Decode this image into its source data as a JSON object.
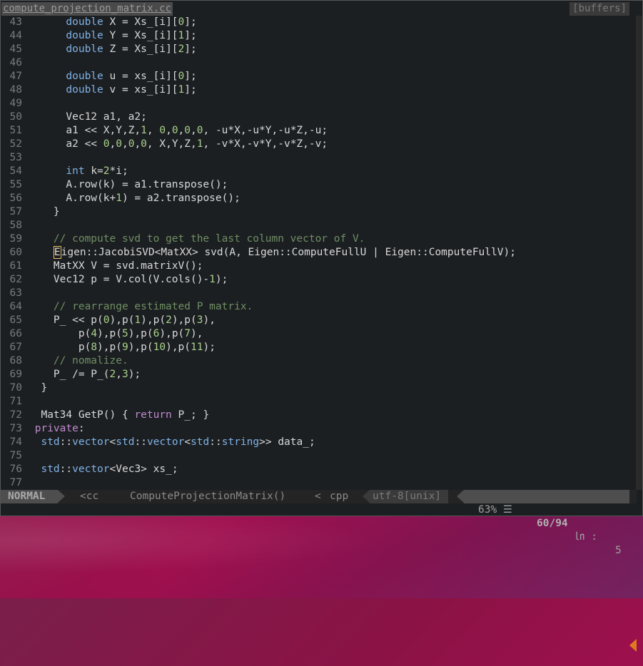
{
  "window": {
    "tab_active": "compute_projection_matrix.cc",
    "tab_buffers": "[buffers]"
  },
  "editor": {
    "lines": [
      {
        "n": "43",
        "segs": [
          [
            "      ",
            ""
          ],
          [
            "double",
            "kw"
          ],
          [
            " X = Xs_[i][",
            ""
          ],
          [
            "0",
            "num"
          ],
          [
            "];",
            ""
          ]
        ]
      },
      {
        "n": "44",
        "segs": [
          [
            "      ",
            ""
          ],
          [
            "double",
            "kw"
          ],
          [
            " Y = Xs_[i][",
            ""
          ],
          [
            "1",
            "num"
          ],
          [
            "];",
            ""
          ]
        ]
      },
      {
        "n": "45",
        "segs": [
          [
            "      ",
            ""
          ],
          [
            "double",
            "kw"
          ],
          [
            " Z = Xs_[i][",
            ""
          ],
          [
            "2",
            "num"
          ],
          [
            "];",
            ""
          ]
        ]
      },
      {
        "n": "46",
        "segs": []
      },
      {
        "n": "47",
        "segs": [
          [
            "      ",
            ""
          ],
          [
            "double",
            "kw"
          ],
          [
            " u = xs_[i][",
            ""
          ],
          [
            "0",
            "num"
          ],
          [
            "];",
            ""
          ]
        ]
      },
      {
        "n": "48",
        "segs": [
          [
            "      ",
            ""
          ],
          [
            "double",
            "kw"
          ],
          [
            " v = xs_[i][",
            ""
          ],
          [
            "1",
            "num"
          ],
          [
            "];",
            ""
          ]
        ]
      },
      {
        "n": "49",
        "segs": []
      },
      {
        "n": "50",
        "segs": [
          [
            "      Vec12 a1, a2;",
            ""
          ]
        ]
      },
      {
        "n": "51",
        "segs": [
          [
            "      a1 << X,Y,Z,",
            ""
          ],
          [
            "1",
            "num"
          ],
          [
            ", ",
            ""
          ],
          [
            "0",
            "num"
          ],
          [
            ",",
            ""
          ],
          [
            "0",
            "num"
          ],
          [
            ",",
            ""
          ],
          [
            "0",
            "num"
          ],
          [
            ",",
            ""
          ],
          [
            "0",
            "num"
          ],
          [
            ", -u*X,-u*Y,-u*Z,-u;",
            ""
          ]
        ]
      },
      {
        "n": "52",
        "segs": [
          [
            "      a2 << ",
            ""
          ],
          [
            "0",
            "num"
          ],
          [
            ",",
            ""
          ],
          [
            "0",
            "num"
          ],
          [
            ",",
            ""
          ],
          [
            "0",
            "num"
          ],
          [
            ",",
            ""
          ],
          [
            "0",
            "num"
          ],
          [
            ", X,Y,Z,",
            ""
          ],
          [
            "1",
            "num"
          ],
          [
            ", -v*X,-v*Y,-v*Z,-v;",
            ""
          ]
        ]
      },
      {
        "n": "53",
        "segs": []
      },
      {
        "n": "54",
        "segs": [
          [
            "      ",
            ""
          ],
          [
            "int",
            "kw"
          ],
          [
            " k=",
            ""
          ],
          [
            "2",
            "num"
          ],
          [
            "*i;",
            ""
          ]
        ]
      },
      {
        "n": "55",
        "segs": [
          [
            "      A.row(k) = a1.transpose();",
            ""
          ]
        ]
      },
      {
        "n": "56",
        "segs": [
          [
            "      A.row(k+",
            ""
          ],
          [
            "1",
            "num"
          ],
          [
            ") = a2.transpose();",
            ""
          ]
        ]
      },
      {
        "n": "57",
        "segs": [
          [
            "    }",
            ""
          ]
        ]
      },
      {
        "n": "58",
        "segs": []
      },
      {
        "n": "59",
        "segs": [
          [
            "    ",
            ""
          ],
          [
            "// compute svd to get the last column vector of V.",
            "cm"
          ]
        ]
      },
      {
        "n": "60",
        "segs": [
          [
            "    ",
            ""
          ],
          [
            "E",
            "cursor"
          ],
          [
            "igen::JacobiSVD<MatXX> svd(A, Eigen::ComputeFullU | Eigen::ComputeFullV);",
            ""
          ]
        ]
      },
      {
        "n": "61",
        "segs": [
          [
            "    MatXX V = svd.matrixV();",
            ""
          ]
        ]
      },
      {
        "n": "62",
        "segs": [
          [
            "    Vec12 p = V.col(V.cols()-",
            ""
          ],
          [
            "1",
            "num"
          ],
          [
            ");",
            ""
          ]
        ]
      },
      {
        "n": "63",
        "segs": []
      },
      {
        "n": "64",
        "segs": [
          [
            "    ",
            ""
          ],
          [
            "// rearrange estimated P matrix.",
            "cm"
          ]
        ]
      },
      {
        "n": "65",
        "segs": [
          [
            "    P_ << p(",
            ""
          ],
          [
            "0",
            "num"
          ],
          [
            "),p(",
            ""
          ],
          [
            "1",
            "num"
          ],
          [
            "),p(",
            ""
          ],
          [
            "2",
            "num"
          ],
          [
            "),p(",
            ""
          ],
          [
            "3",
            "num"
          ],
          [
            "),",
            ""
          ]
        ]
      },
      {
        "n": "66",
        "segs": [
          [
            "        p(",
            ""
          ],
          [
            "4",
            "num"
          ],
          [
            "),p(",
            ""
          ],
          [
            "5",
            "num"
          ],
          [
            "),p(",
            ""
          ],
          [
            "6",
            "num"
          ],
          [
            "),p(",
            ""
          ],
          [
            "7",
            "num"
          ],
          [
            "),",
            ""
          ]
        ]
      },
      {
        "n": "67",
        "segs": [
          [
            "        p(",
            ""
          ],
          [
            "8",
            "num"
          ],
          [
            "),p(",
            ""
          ],
          [
            "9",
            "num"
          ],
          [
            "),p(",
            ""
          ],
          [
            "10",
            "num"
          ],
          [
            "),p(",
            ""
          ],
          [
            "11",
            "num"
          ],
          [
            ");",
            ""
          ]
        ]
      },
      {
        "n": "68",
        "segs": [
          [
            "    ",
            ""
          ],
          [
            "// nomalize.",
            "cm"
          ]
        ]
      },
      {
        "n": "69",
        "segs": [
          [
            "    P_ /= P_(",
            ""
          ],
          [
            "2",
            "num"
          ],
          [
            ",",
            ""
          ],
          [
            "3",
            "num"
          ],
          [
            ");",
            ""
          ]
        ]
      },
      {
        "n": "70",
        "segs": [
          [
            "  }",
            ""
          ]
        ]
      },
      {
        "n": "71",
        "segs": []
      },
      {
        "n": "72",
        "segs": [
          [
            "  Mat34 GetP() { ",
            ""
          ],
          [
            "return",
            "kw2"
          ],
          [
            " P_; }",
            ""
          ]
        ]
      },
      {
        "n": "73",
        "segs": [
          [
            " ",
            ""
          ],
          [
            "private",
            "kw2"
          ],
          [
            ":",
            ""
          ]
        ]
      },
      {
        "n": "74",
        "segs": [
          [
            "  ",
            ""
          ],
          [
            "std",
            "kw"
          ],
          [
            "::",
            ""
          ],
          [
            "vector",
            "kw"
          ],
          [
            "<",
            ""
          ],
          [
            "std",
            "kw"
          ],
          [
            "::",
            ""
          ],
          [
            "vector",
            "kw"
          ],
          [
            "<",
            ""
          ],
          [
            "std",
            "kw"
          ],
          [
            "::",
            ""
          ],
          [
            "string",
            "kw"
          ],
          [
            ">> data_;",
            ""
          ]
        ]
      },
      {
        "n": "75",
        "segs": []
      },
      {
        "n": "76",
        "segs": [
          [
            "  ",
            ""
          ],
          [
            "std",
            "kw"
          ],
          [
            "::",
            ""
          ],
          [
            "vector",
            "kw"
          ],
          [
            "<Vec3> xs_;",
            ""
          ]
        ]
      },
      {
        "n": "77",
        "segs": []
      }
    ]
  },
  "statusline": {
    "mode": "NORMAL",
    "section": "<cc",
    "function": "ComputeProjectionMatrix()",
    "sep": "<",
    "filetype": "cpp",
    "encoding": "utf-8[unix]",
    "percent": "63% ☰",
    "lineno": "60/94",
    "col_label": "㏑ :",
    "col_value": "5"
  },
  "colors": {
    "editor_bg": "#1c1f22",
    "keyword": "#7fb2e6",
    "keyword2": "#c08ad0",
    "number": "#a8d08a",
    "comment": "#6f8e63",
    "warning": "#e07a20",
    "desktop": "#8b1245"
  }
}
